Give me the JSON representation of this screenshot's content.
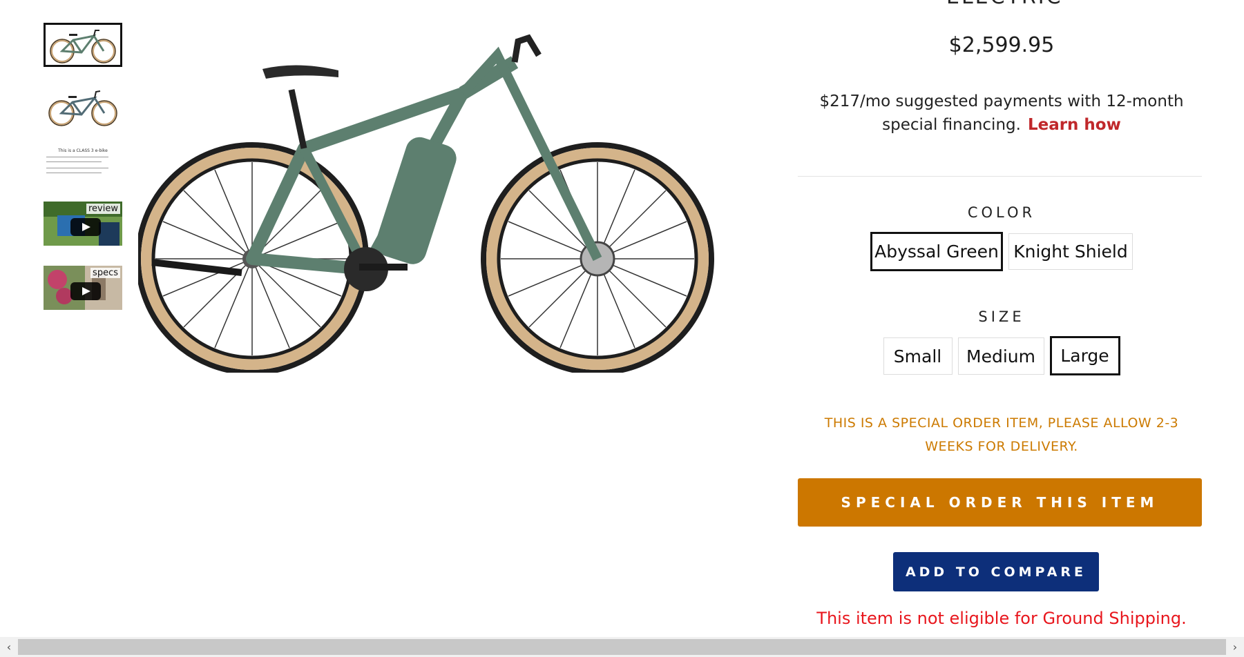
{
  "header": {
    "partial_title": "ELECTRIC"
  },
  "thumbnails": [
    {
      "type": "image",
      "label": ""
    },
    {
      "type": "image",
      "label": ""
    },
    {
      "type": "image",
      "label": "",
      "title": "This is a CLASS 3 e-bike"
    },
    {
      "type": "video",
      "label": "review"
    },
    {
      "type": "video",
      "label": "specs"
    }
  ],
  "product": {
    "price": "$2,599.95",
    "financing_text": "$217/mo suggested payments with 12-month special financing.",
    "financing_link": "Learn how"
  },
  "color": {
    "label": "COLOR",
    "options": [
      "Abyssal Green",
      "Knight Shield"
    ],
    "selected": "Abyssal Green"
  },
  "size": {
    "label": "SIZE",
    "options": [
      "Small",
      "Medium",
      "Large"
    ],
    "selected": "Large"
  },
  "special_note": "THIS IS A SPECIAL ORDER ITEM, PLEASE ALLOW 2-3 WEEKS FOR DELIVERY.",
  "buttons": {
    "special_order": "SPECIAL ORDER THIS ITEM",
    "compare": "ADD TO COMPARE"
  },
  "shipping_note": "This item is not eligible for Ground Shipping.",
  "colors": {
    "frame": "#5d7f6f",
    "tire": "#d4b48a",
    "special": "#cc7700",
    "compare": "#0d2f7a",
    "link": "#c0282b",
    "warning": "#e8161d"
  },
  "scrollbar": {
    "left_arrow": "‹",
    "right_arrow": "›"
  }
}
